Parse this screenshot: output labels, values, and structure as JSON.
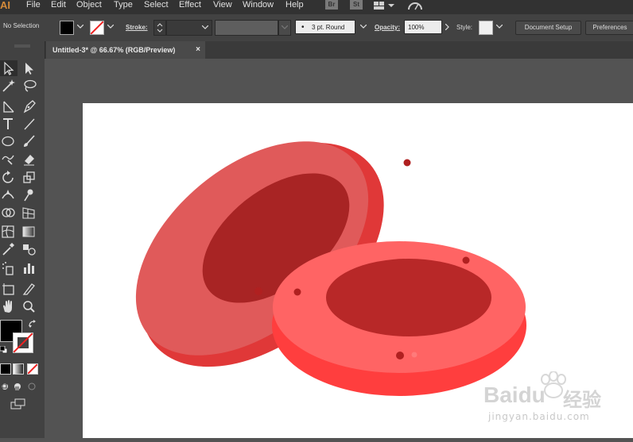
{
  "menubar": {
    "logo": "AI",
    "items": [
      "File",
      "Edit",
      "Object",
      "Type",
      "Select",
      "Effect",
      "View",
      "Window",
      "Help"
    ],
    "badge_br": "Br",
    "badge_st": "St"
  },
  "control": {
    "selection_label": "No Selection",
    "stroke_label": "Stroke:",
    "brush_label": "3 pt. Round",
    "opacity_label": "Opacity:",
    "opacity_value": "100%",
    "style_label": "Style:",
    "doc_setup": "Document Setup",
    "preferences": "Preferences"
  },
  "document": {
    "tab_title": "Untitled-3* @ 66.67% (RGB/Preview)",
    "close_glyph": "×"
  },
  "watermark": {
    "brand": "Baidu",
    "cn": "经验",
    "url": "jingyan.baidu.com"
  },
  "colors": {
    "cell_back_top": "#e05a5a",
    "cell_back_side": "#e03838",
    "cell_back_hole": "#a82424",
    "cell_front_top": "#ff6464",
    "cell_front_side": "#ff3e3e",
    "cell_front_hole": "#b82828",
    "dot": "#b02020"
  }
}
